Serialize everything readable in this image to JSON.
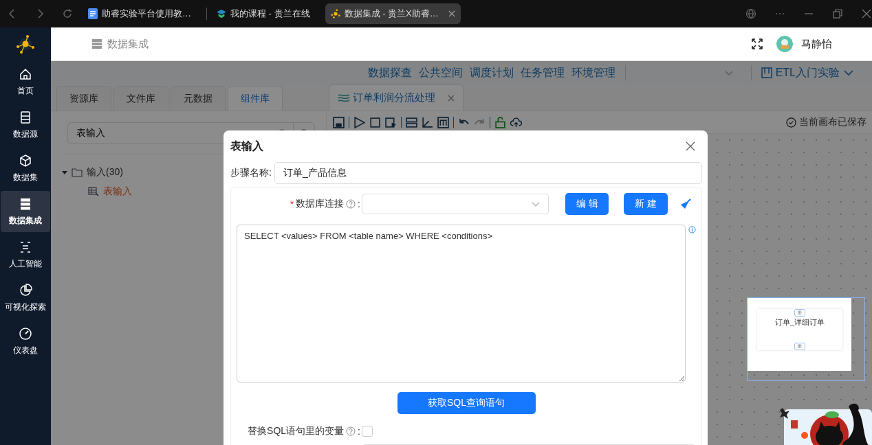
{
  "browser": {
    "tabs": [
      {
        "title": "助睿实验平台使用教…",
        "selected": false
      },
      {
        "title": "我的课程 - 贵兰在线",
        "selected": false
      },
      {
        "title": "数据集成 - 贵兰X助睿…",
        "selected": true
      }
    ]
  },
  "sidebar": {
    "items": [
      {
        "label": "首页",
        "selected": false
      },
      {
        "label": "数据源",
        "selected": false
      },
      {
        "label": "数据集",
        "selected": false
      },
      {
        "label": "数据集成",
        "selected": true
      },
      {
        "label": "人工智能",
        "selected": false
      },
      {
        "label": "可视化探索",
        "selected": false
      },
      {
        "label": "仪表盘",
        "selected": false
      }
    ]
  },
  "header": {
    "breadcrumb": "数据集成",
    "user": "马静怡"
  },
  "top_nav": {
    "links": [
      "数据探查",
      "公共空间",
      "调度计划",
      "任务管理",
      "环境管理"
    ],
    "project": "ETL入门实验"
  },
  "library": {
    "tabs": [
      {
        "label": "资源库",
        "selected": false
      },
      {
        "label": "文件库",
        "selected": false
      },
      {
        "label": "元数据",
        "selected": false
      },
      {
        "label": "组件库",
        "selected": true
      }
    ],
    "search": {
      "value": "表输入"
    },
    "tree": [
      {
        "label": "输入(30)",
        "expanded": true,
        "selected": false,
        "children": [
          {
            "label": "表输入",
            "selected": true
          }
        ]
      }
    ]
  },
  "editor": {
    "tab": "订单利润分流处理",
    "status": "当前画布已保存",
    "minimap": {
      "node_label": "订单_详细订单"
    }
  },
  "dialog": {
    "title": "表输入",
    "step_name": {
      "label": "步骤名称:",
      "value": "订单_产品信息"
    },
    "connection": {
      "required_mark": "*",
      "label": "数据库连接",
      "separator": ":"
    },
    "buttons": [
      "编 辑",
      "新 建"
    ],
    "sql": "SELECT <values> FROM <table name> WHERE <conditions>",
    "fetch_button": "获取SQL查询语句",
    "replace_vars": {
      "label": "替换SQL语句里的变量",
      "separator": ":",
      "checked": false
    }
  }
}
